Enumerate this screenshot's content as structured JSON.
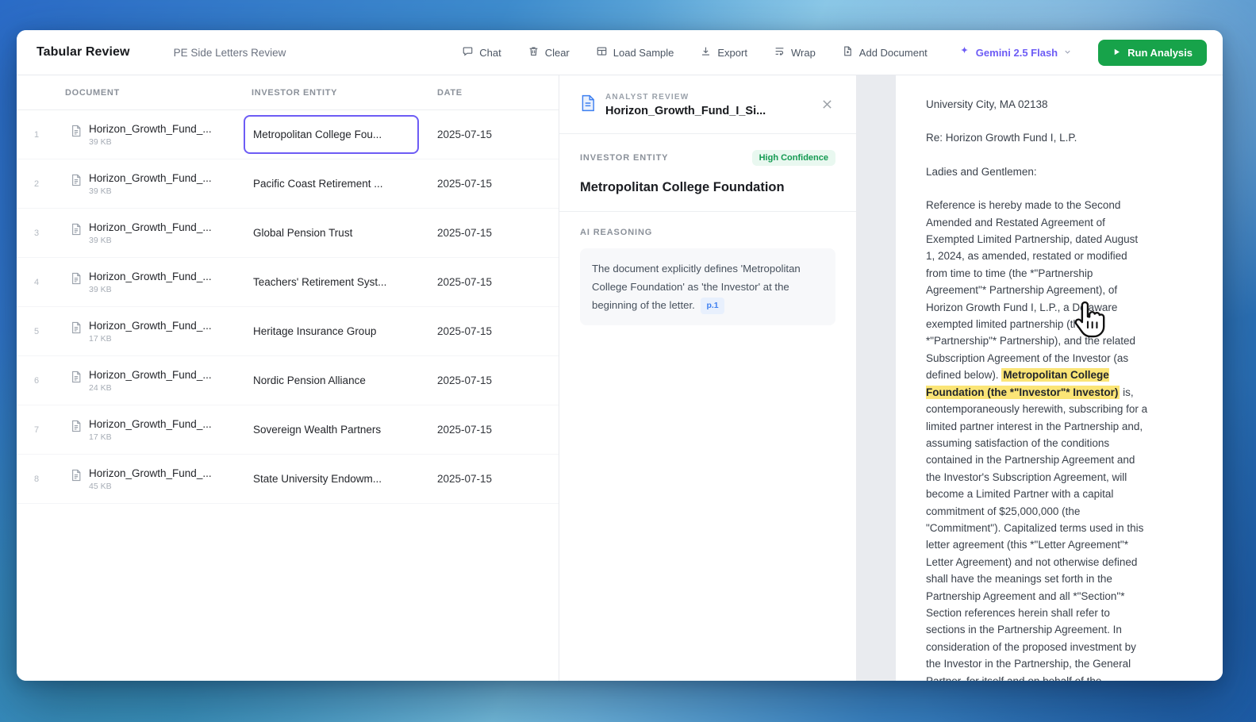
{
  "window": {
    "app_title": "Tabular Review",
    "subtitle": "PE Side Letters Review"
  },
  "toolbar": {
    "chat": "Chat",
    "clear": "Clear",
    "load_sample": "Load Sample",
    "export": "Export",
    "wrap": "Wrap",
    "add_document": "Add Document",
    "model_selector": "Gemini 2.5 Flash",
    "run_analysis": "Run Analysis"
  },
  "table": {
    "columns": {
      "document": "DOCUMENT",
      "investor_entity": "INVESTOR ENTITY",
      "date": "DATE"
    },
    "rows": [
      {
        "num": "1",
        "document": "Horizon_Growth_Fund_...",
        "size": "39 KB",
        "entity": "Metropolitan College Fou...",
        "date": "2025-07-15"
      },
      {
        "num": "2",
        "document": "Horizon_Growth_Fund_...",
        "size": "39 KB",
        "entity": "Pacific Coast Retirement ...",
        "date": "2025-07-15"
      },
      {
        "num": "3",
        "document": "Horizon_Growth_Fund_...",
        "size": "39 KB",
        "entity": "Global Pension Trust",
        "date": "2025-07-15"
      },
      {
        "num": "4",
        "document": "Horizon_Growth_Fund_...",
        "size": "39 KB",
        "entity": "Teachers' Retirement Syst...",
        "date": "2025-07-15"
      },
      {
        "num": "5",
        "document": "Horizon_Growth_Fund_...",
        "size": "17 KB",
        "entity": "Heritage Insurance Group",
        "date": "2025-07-15"
      },
      {
        "num": "6",
        "document": "Horizon_Growth_Fund_...",
        "size": "24 KB",
        "entity": "Nordic Pension Alliance",
        "date": "2025-07-15"
      },
      {
        "num": "7",
        "document": "Horizon_Growth_Fund_...",
        "size": "17 KB",
        "entity": "Sovereign Wealth Partners",
        "date": "2025-07-15"
      },
      {
        "num": "8",
        "document": "Horizon_Growth_Fund_...",
        "size": "45 KB",
        "entity": "State University Endowm...",
        "date": "2025-07-15"
      }
    ]
  },
  "analyst_panel": {
    "eyebrow": "ANALYST REVIEW",
    "doc_title": "Horizon_Growth_Fund_I_Si...",
    "field_label": "INVESTOR ENTITY",
    "confidence": "High Confidence",
    "value": "Metropolitan College Foundation",
    "reasoning_label": "AI REASONING",
    "reasoning_text": "The document explicitly defines 'Metropolitan College Foundation' as 'the Investor' at the beginning of the letter.",
    "page_ref": "p.1"
  },
  "document_view": {
    "line_address": "University City, MA 02138",
    "line_re": "Re: Horizon Growth Fund I, L.P.",
    "line_salutation": "Ladies and Gentlemen:",
    "para_before": "Reference is hereby made to the Second Amended and Restated Agreement of Exempted Limited Partnership, dated August 1, 2024, as amended, restated or modified from time to time (the *\"Partnership Agreement\"* Partnership Agreement), of Horizon Growth Fund I, L.P., a Delaware exempted limited partnership (the *\"Partnership\"* Partnership), and the related Subscription Agreement of the Investor (as defined below). ",
    "para_highlight": "Metropolitan College Foundation (the *\"Investor\"* Investor)",
    "para_after": " is, contemporaneously herewith, subscribing for a limited partner interest in the Partnership and, assuming satisfaction of the conditions contained in the Partnership Agreement and the Investor's Subscription Agreement, will become a Limited Partner with a capital commitment of $25,000,000 (the \"Commitment\"). Capitalized terms used in this letter agreement (this *\"Letter Agreement\"* Letter Agreement) and not otherwise defined shall have the meanings set forth in the Partnership Agreement and all *\"Section\"* Section references herein shall refer to sections in the Partnership Agreement. In consideration of the proposed investment by the Investor in the Partnership, the General Partner, for itself and on behalf of the"
  },
  "colors": {
    "accent_purple": "#6d5cf5",
    "run_green": "#17a34a",
    "confidence_green": "#149a52",
    "highlight_yellow": "#fbe576",
    "page_badge_blue": "#3d7ff0"
  }
}
